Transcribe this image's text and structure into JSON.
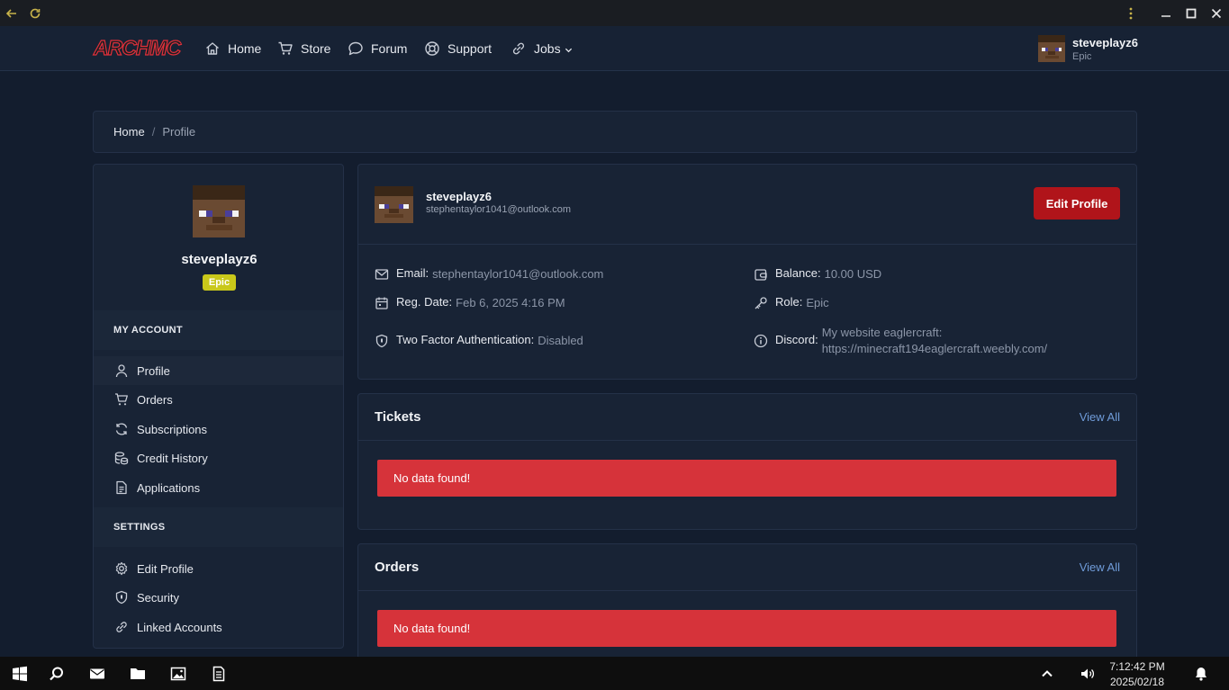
{
  "browser": {
    "back_icon": "arrow-left-icon",
    "reload_icon": "reload-icon",
    "menu_icon": "kebab-menu-icon"
  },
  "nav": {
    "logo_text": "ARCHMC",
    "items": [
      {
        "label": "Home",
        "icon": "home-icon"
      },
      {
        "label": "Store",
        "icon": "cart-icon"
      },
      {
        "label": "Forum",
        "icon": "chat-icon"
      },
      {
        "label": "Support",
        "icon": "lifebuoy-icon"
      },
      {
        "label": "Jobs",
        "icon": "link-icon"
      }
    ],
    "user": {
      "name": "steveplayz6",
      "role": "Epic"
    }
  },
  "breadcrumb": {
    "home": "Home",
    "separator": "/",
    "current": "Profile"
  },
  "sidebar": {
    "username": "steveplayz6",
    "badge": "Epic",
    "account_heading": "MY ACCOUNT",
    "account_items": [
      {
        "label": "Profile",
        "icon": "user-icon"
      },
      {
        "label": "Orders",
        "icon": "cart-icon"
      },
      {
        "label": "Subscriptions",
        "icon": "refresh-icon"
      },
      {
        "label": "Credit History",
        "icon": "coins-icon"
      },
      {
        "label": "Applications",
        "icon": "document-icon"
      }
    ],
    "settings_heading": "SETTINGS",
    "settings_items": [
      {
        "label": "Edit Profile",
        "icon": "gear-icon"
      },
      {
        "label": "Security",
        "icon": "shield-icon"
      },
      {
        "label": "Linked Accounts",
        "icon": "link-icon"
      }
    ]
  },
  "profile": {
    "name": "steveplayz6",
    "email": "stephentaylor1041@outlook.com",
    "edit_button": "Edit Profile",
    "fields": {
      "email_label": "Email:",
      "email_value": "stephentaylor1041@outlook.com",
      "reg_label": "Reg. Date:",
      "reg_value": "Feb 6, 2025 4:16 PM",
      "twofa_label": "Two Factor Authentication:",
      "twofa_value": "Disabled",
      "balance_label": "Balance:",
      "balance_value": "10.00 USD",
      "role_label": "Role:",
      "role_value": "Epic",
      "discord_label": "Discord:",
      "discord_value": "My website eaglercraft: https://minecraft194eaglercraft.weebly.com/"
    }
  },
  "tickets": {
    "title": "Tickets",
    "view_all": "View All",
    "empty": "No data found!"
  },
  "orders": {
    "title": "Orders",
    "view_all": "View All",
    "empty": "No data found!"
  },
  "taskbar": {
    "time": "7:12:42 PM",
    "date": "2025/02/18"
  },
  "colors": {
    "background": "#131d2e",
    "card": "#182335",
    "accent_button": "#b0141a",
    "alert": "#d6333a",
    "badge": "#c9c81a",
    "link": "#6f9bd8"
  }
}
